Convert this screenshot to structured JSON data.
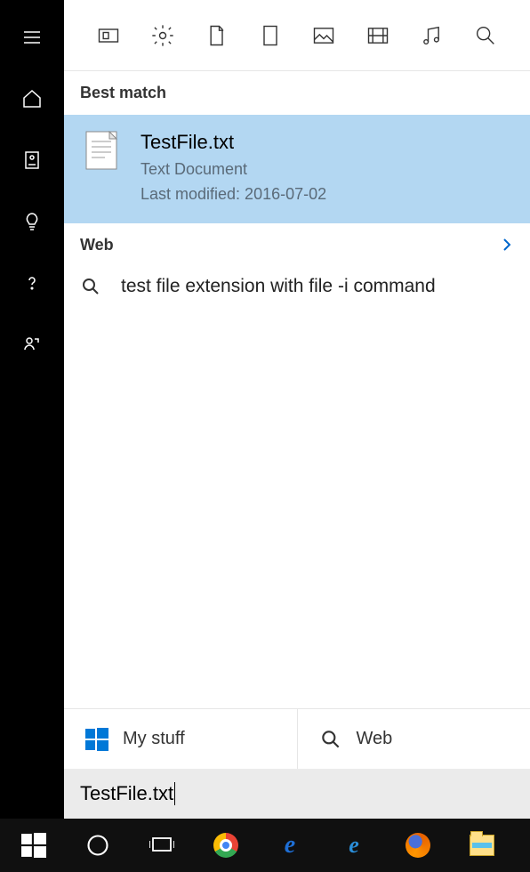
{
  "sections": {
    "best_match": "Best match",
    "web": "Web"
  },
  "best_result": {
    "title": "TestFile.txt",
    "type": "Text Document",
    "modified_label": "Last modified: 2016-07-02"
  },
  "web_suggestion": "test file extension with file -i command",
  "bottom_tabs": {
    "my_stuff": "My stuff",
    "web": "Web"
  },
  "search_value": "TestFile.txt"
}
